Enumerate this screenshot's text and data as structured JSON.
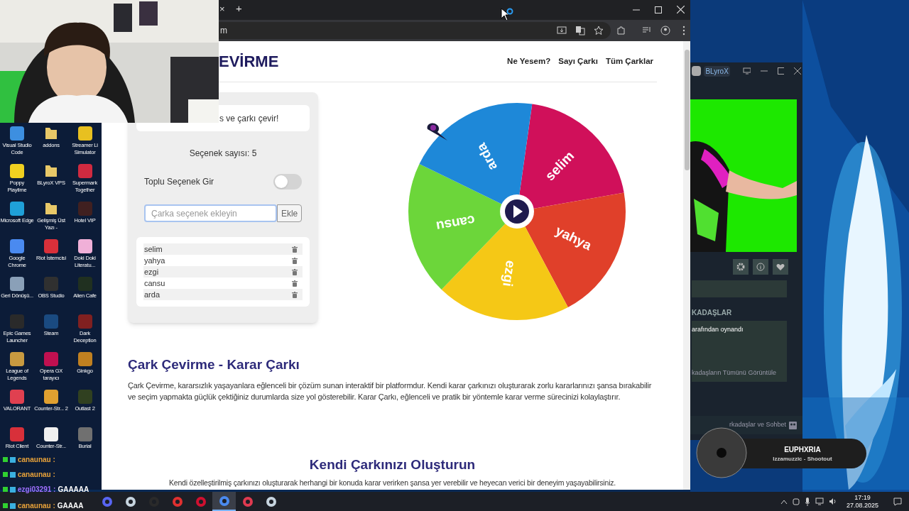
{
  "desktop_icons": [
    {
      "label": "Visual Studio Code",
      "kind": "app",
      "color": "#3d8fe0"
    },
    {
      "label": "addons",
      "kind": "folder",
      "color": "#e8c868"
    },
    {
      "label": "Streamer Li Simulator",
      "kind": "app",
      "color": "#e8c020"
    },
    {
      "label": "Poppy Playtime",
      "kind": "app",
      "color": "#f0d020"
    },
    {
      "label": "BLyroX VPS",
      "kind": "folder",
      "color": "#e8c868"
    },
    {
      "label": "Supermark Together",
      "kind": "app",
      "color": "#d02a40"
    },
    {
      "label": "Microsoft Edge",
      "kind": "app",
      "color": "#1fa0d8"
    },
    {
      "label": "Gelişmiş Üst Yazı -",
      "kind": "folder",
      "color": "#e8c868"
    },
    {
      "label": "Hotel VIP",
      "kind": "app",
      "color": "#402020"
    },
    {
      "label": "Google Chrome",
      "kind": "app",
      "color": "#4a8af0"
    },
    {
      "label": "Riot İstemcisi",
      "kind": "app",
      "color": "#d8303a"
    },
    {
      "label": "Doki Doki Literatu...",
      "kind": "app",
      "color": "#f0b0d8"
    },
    {
      "label": "Geri Dönüşü...",
      "kind": "app",
      "color": "#8aa0b8"
    },
    {
      "label": "OBS Studio",
      "kind": "app",
      "color": "#303030"
    },
    {
      "label": "Alien Cafe",
      "kind": "app",
      "color": "#203020"
    },
    {
      "label": "Epic Games Launcher",
      "kind": "app",
      "color": "#2a2a2a"
    },
    {
      "label": "Steam",
      "kind": "app",
      "color": "#1a4a80"
    },
    {
      "label": "Dark Deception",
      "kind": "app",
      "color": "#802020"
    },
    {
      "label": "League of Legends",
      "kind": "app",
      "color": "#c89a40"
    },
    {
      "label": "Opera GX tarayıcı",
      "kind": "app",
      "color": "#c01050"
    },
    {
      "label": "Ginkgo",
      "kind": "app",
      "color": "#c08020"
    },
    {
      "label": "VALORANT",
      "kind": "app",
      "color": "#e04050"
    },
    {
      "label": "Counter-Str... 2",
      "kind": "app",
      "color": "#e0a030"
    },
    {
      "label": "Outlast 2",
      "kind": "app",
      "color": "#304020"
    },
    {
      "label": "Riot Client",
      "kind": "app",
      "color": "#d8303a"
    },
    {
      "label": "Counter-Str...",
      "kind": "app",
      "color": "#f0f0f0"
    },
    {
      "label": "Burial",
      "kind": "app",
      "color": "#707070"
    }
  ],
  "chat": [
    {
      "user": "canaunau :",
      "color": "#e8a23a"
    },
    {
      "user": "canaunau :",
      "color": "#e8a23a"
    },
    {
      "user": "ezgi03291 :",
      "color": "#a070ff",
      "message": "GAAAAA"
    },
    {
      "user": "canaunau :",
      "color": "#e8a23a",
      "message": "GAAAA"
    }
  ],
  "browser": {
    "tab_close": "×",
    "new_tab": "+",
    "address": "m"
  },
  "page": {
    "logo": "EVİRME",
    "nav": [
      "Ne Yesem?",
      "Sayı Çarkı",
      "Tüm Çarklar"
    ],
    "instruction": "s ve çarkı çevir!",
    "count": "Seçenek sayısı: 5",
    "bulk_toggle": {
      "label": "Toplu Seçenek Gir",
      "on": false
    },
    "input": {
      "placeholder": "Çarka seçenek ekleyin"
    },
    "add_button": "Ekle",
    "options": [
      {
        "label": "selim"
      },
      {
        "label": "yahya"
      },
      {
        "label": "ezgi"
      },
      {
        "label": "cansu"
      },
      {
        "label": "arda"
      }
    ],
    "wheel": {
      "slices": [
        {
          "label": "selim",
          "color": "#d0105a"
        },
        {
          "label": "yahya",
          "color": "#e0402a"
        },
        {
          "label": "ezgi",
          "color": "#f5c816"
        },
        {
          "label": "cansu",
          "color": "#6cd63a"
        },
        {
          "label": "arda",
          "color": "#1e88d8"
        }
      ]
    },
    "heading": "Çark Çevirme - Karar Çarkı",
    "paragraph": "Çark Çevirme, kararsızlık yaşayanlara eğlenceli bir çözüm sunan interaktif bir platformdur. Kendi karar çarkınızı oluşturarak zorlu kararlarınızı şansa bırakabilir ve seçim yapmakta güçlük çektiğiniz durumlarda size yol gösterebilir. Karar Çarkı, eğlenceli ve pratik bir yöntemle karar verme sürecinizi kolaylaştırır.",
    "heading2": "Kendi Çarkınızı Oluşturun",
    "paragraph2": "Kendi özelleştirilmiş çarkınızı oluşturarak herhangi bir konuda karar verirken şansa yer verebilir ve heyecan verici bir deneyim yaşayabilirsiniz."
  },
  "steam": {
    "user": "BLyroX",
    "section": "KADAŞLAR",
    "activity": "arafından oynandı",
    "view_all": "kadaşların Tümünü Görüntüle",
    "footer": "rkadaşlar ve Sohbet"
  },
  "music": {
    "title": "EUPHXRIA",
    "track": "Izzamuzzic - Shootout"
  },
  "taskbar": {
    "apps": [
      {
        "kind": "chat",
        "selected": false
      },
      {
        "kind": "steam",
        "selected": false
      },
      {
        "kind": "epic",
        "selected": false
      },
      {
        "kind": "red",
        "selected": false
      },
      {
        "kind": "opera",
        "selected": false
      },
      {
        "kind": "chrome",
        "selected": true
      },
      {
        "kind": "game",
        "selected": false
      },
      {
        "kind": "steam",
        "selected": false
      }
    ],
    "time": "17:19",
    "date": "27.08.2025"
  }
}
